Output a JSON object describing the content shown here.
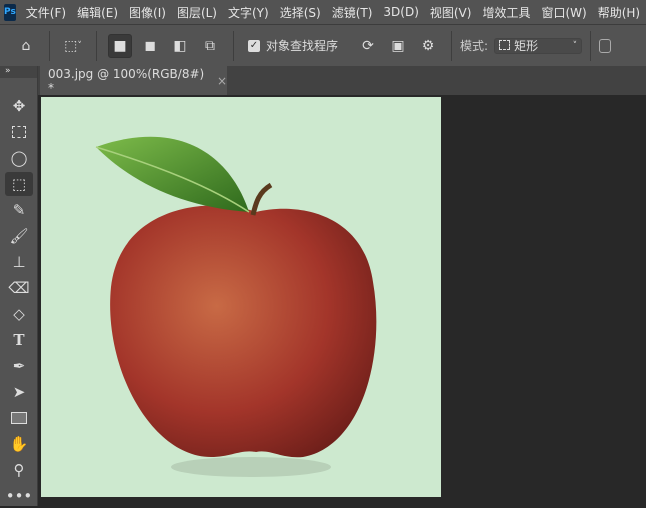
{
  "app": {
    "logo": "Ps"
  },
  "menu": [
    "文件(F)",
    "编辑(E)",
    "图像(I)",
    "图层(L)",
    "文字(Y)",
    "选择(S)",
    "滤镜(T)",
    "3D(D)",
    "视图(V)",
    "增效工具",
    "窗口(W)",
    "帮助(H)"
  ],
  "options": {
    "object_finder_label": "对象查找程序",
    "object_finder_checked": true,
    "mode_label": "模式:",
    "mode_value": "矩形"
  },
  "document_tab": {
    "title": "003.jpg @ 100%(RGB/8#) *",
    "close": "×"
  },
  "tools": [
    "move",
    "rectangular-marquee",
    "lasso",
    "object-selection",
    "eyedropper",
    "brush",
    "clone-stamp",
    "eraser",
    "paint-bucket",
    "type",
    "pen",
    "path-selection",
    "rectangle",
    "hand",
    "zoom",
    "more"
  ],
  "active_tool": "object-selection",
  "colors": {
    "canvas_bg": "#cde9cf",
    "ui": "#535353",
    "workspace": "#282828"
  }
}
